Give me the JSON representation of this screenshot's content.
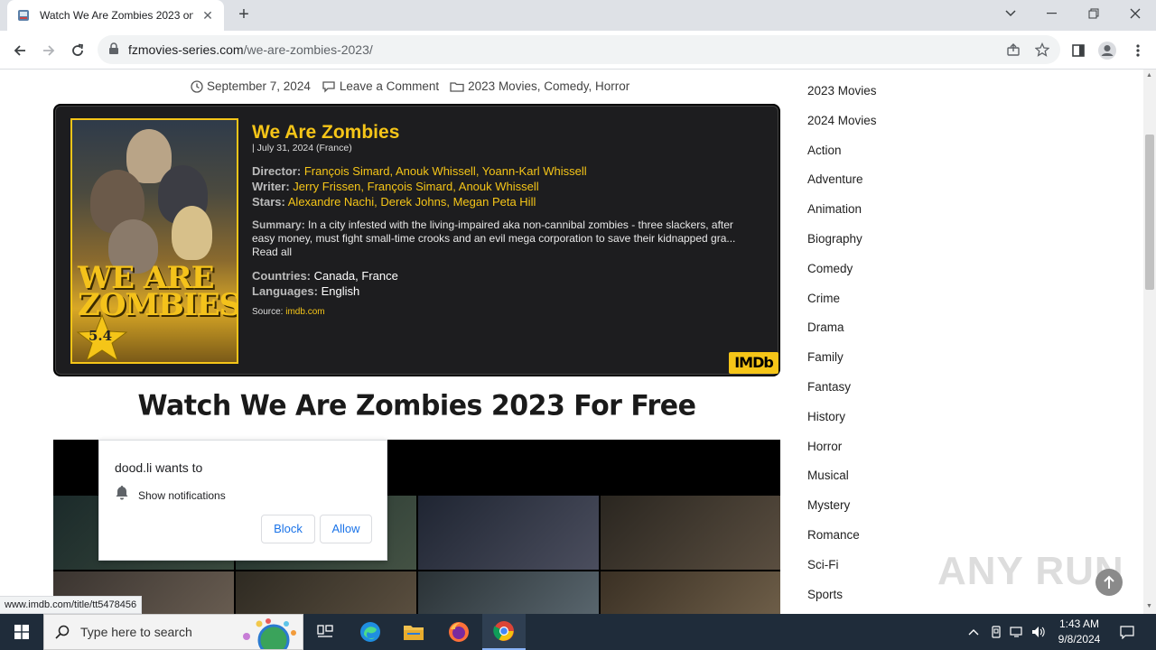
{
  "browser": {
    "tab_title": "Watch We Are Zombies 2023 on",
    "url_host": "fzmovies-series.com",
    "url_path": "/we-are-zombies-2023/"
  },
  "post_meta": {
    "date": "September 7, 2024",
    "comment": "Leave a Comment",
    "categories": "2023 Movies, Comedy, Horror"
  },
  "movie_card": {
    "title": "We Are Zombies",
    "date_line": "| July 31, 2024 (France)",
    "poster_title": "WE ARE ZOMBIES",
    "rating": "5.4",
    "director_label": "Director:",
    "directors": "François Simard, Anouk Whissell, Yoann-Karl Whissell",
    "writer_label": "Writer:",
    "writers": "Jerry Frissen, François Simard, Anouk Whissell",
    "stars_label": "Stars:",
    "stars": "Alexandre Nachi, Derek Johns, Megan Peta Hill",
    "summary_label": "Summary:",
    "summary": "In a city infested with the living-impaired aka non-cannibal zombies - three slackers, after easy money, must fight small-time crooks and an evil mega corporation to save their kidnapped gra...",
    "read_all": "Read all",
    "countries_label": "Countries:",
    "countries": "Canada, France",
    "languages_label": "Languages:",
    "languages": "English",
    "source_label": "Source:",
    "source_link": "imdb.com",
    "imdb_logo": "IMDb"
  },
  "watch_heading": "Watch We Are Zombies 2023 For Free",
  "sidebar": {
    "categories": [
      "2023 Movies",
      "2024 Movies",
      "Action",
      "Adventure",
      "Animation",
      "Biography",
      "Comedy",
      "Crime",
      "Drama",
      "Family",
      "Fantasy",
      "History",
      "Horror",
      "Musical",
      "Mystery",
      "Romance",
      "Sci-Fi",
      "Sports"
    ]
  },
  "notification_popup": {
    "title": "dood.li wants to",
    "message": "Show notifications",
    "block_label": "Block",
    "allow_label": "Allow"
  },
  "status_url": "www.imdb.com/title/tt5478456",
  "watermark": "ANY RUN",
  "taskbar": {
    "search_placeholder": "Type here to search",
    "time": "1:43 AM",
    "date": "9/8/2024"
  },
  "colors": {
    "imdb_yellow": "#f5c518",
    "card_bg": "#1d1d1f",
    "taskbar": "#1f2c3a",
    "link_blue": "#1a73e8"
  }
}
